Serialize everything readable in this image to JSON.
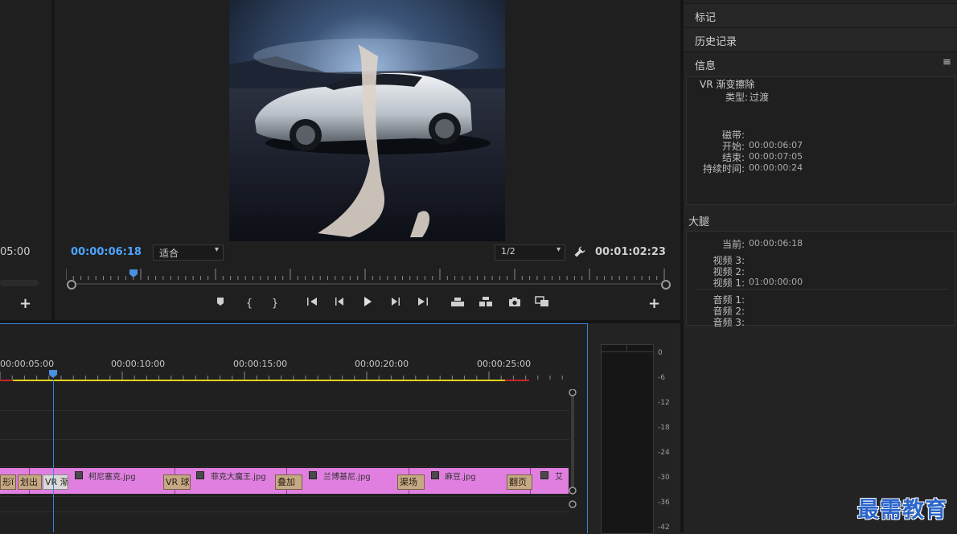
{
  "source_monitor": {
    "timecode": "05:00",
    "add_label": "+"
  },
  "program_monitor": {
    "position_timecode": "00:00:06:18",
    "fit_select": "适合",
    "resolution_select": "1/2",
    "duration_timecode": "00:01:02:23",
    "playhead_fraction": 0.106,
    "transport_icons": [
      "marker-icon",
      "mark-in-icon",
      "mark-out-icon",
      "go-to-in-icon",
      "step-back-icon",
      "play-icon",
      "step-forward-icon",
      "go-to-out-icon",
      "lift-icon",
      "extract-icon",
      "camera-icon",
      "comparison-view-icon"
    ],
    "add_label": "+"
  },
  "panels": {
    "markers_tab": "标记",
    "history_tab": "历史记录",
    "info_tab": "信息",
    "menu_glyph": "≡"
  },
  "info": {
    "title": "VR 渐变擦除",
    "type_label": "类型:",
    "type_value": "过渡",
    "tape_label": "磁带:",
    "start_label": "开始:",
    "start_value": "00:00:06:07",
    "end_label": "结束:",
    "end_value": "00:00:07:05",
    "duration_label": "持续时间:",
    "duration_value": "00:00:00:24"
  },
  "sequence": {
    "name": "大腿",
    "current_label": "当前:",
    "current_value": "00:00:06:18",
    "video3_label": "视频 3:",
    "video2_label": "视频 2:",
    "video1_label": "视频 1:",
    "video1_value": "01:00:00:00",
    "audio1_label": "音频 1:",
    "audio2_label": "音频 2:",
    "audio3_label": "音频 3:"
  },
  "timeline": {
    "ruler_labels": [
      "00:00:05:00",
      "00:00:10:00",
      "00:00:15:00",
      "00:00:20:00",
      "00:00:25:00"
    ],
    "clips": [
      "柯尼塞克.jpg",
      "菲克大魔王.jpg",
      "兰博基尼.jpg",
      "麻豆.jpg",
      "艾"
    ],
    "transitions": [
      "形ǐ",
      "划出",
      "VR 渐",
      "VR 球",
      "叠加",
      "渠场",
      "翻页"
    ]
  },
  "meter": {
    "scale": [
      "0",
      "-6",
      "-12",
      "-18",
      "-24",
      "-30",
      "-36",
      "-42"
    ]
  },
  "watermark": "最需教育"
}
